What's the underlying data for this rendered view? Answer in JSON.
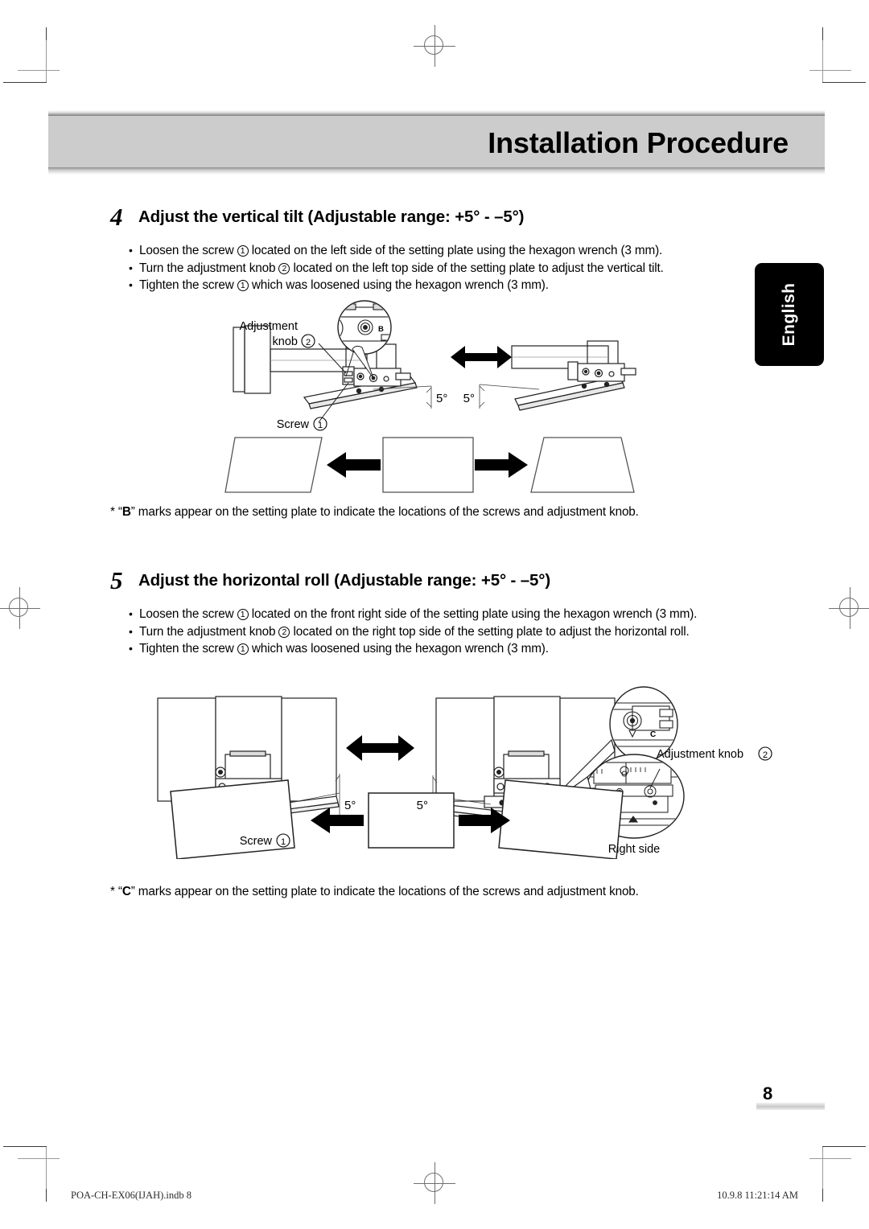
{
  "header": {
    "title": "Installation Procedure"
  },
  "language_tab": {
    "label": "English"
  },
  "steps": [
    {
      "number": "4",
      "title": "Adjust the vertical tilt (Adjustable range: +5° - –5°)",
      "bullets": [
        {
          "pre": "Loosen the screw ",
          "marker": "1",
          "post": " located on the left side of the setting plate using the hexagon wrench (3 mm)."
        },
        {
          "pre": "Turn the adjustment knob ",
          "marker": "2",
          "post": " located on the left top side of the setting plate to adjust the vertical tilt."
        },
        {
          "pre": "Tighten the screw ",
          "marker": "1",
          "post": " which was loosened using the hexagon wrench (3 mm)."
        }
      ],
      "figure_labels": {
        "adjustment_knob_line1": "Adjustment",
        "adjustment_knob_line2": "knob",
        "adjustment_knob_marker": "2",
        "screw_label": "Screw",
        "screw_marker": "1",
        "detail_mark": "B",
        "angle_left": "5°",
        "angle_right": "5°"
      },
      "footnote_prefix": "* “",
      "footnote_mark": "B",
      "footnote_suffix": "” marks appear on the setting plate to indicate the locations of the screws and adjustment knob."
    },
    {
      "number": "5",
      "title": "Adjust the horizontal roll (Adjustable range: +5° - –5°)",
      "bullets": [
        {
          "pre": "Loosen the screw ",
          "marker": "1",
          "post": " located on the front right side of the setting plate using the hexagon wrench (3 mm)."
        },
        {
          "pre": "Turn the adjustment knob ",
          "marker": "2",
          "post": " located on the right top side of the setting plate to adjust the horizontal roll."
        },
        {
          "pre": "Tighten the screw ",
          "marker": "1",
          "post": " which was loosened using the hexagon wrench (3 mm)."
        }
      ],
      "figure_labels": {
        "screw_label": "Screw",
        "screw_marker": "1",
        "adjustment_knob_label": "Adjustment knob",
        "adjustment_knob_marker": "2",
        "right_side_label": "Right side",
        "detail_mark": "C",
        "angle_left": "5°",
        "angle_right": "5°"
      },
      "footnote_prefix": "* “",
      "footnote_mark": "C",
      "footnote_suffix": "” marks appear on the setting plate to indicate the locations of the screws and adjustment knob."
    }
  ],
  "page_number": "8",
  "print_footer": {
    "file": "POA-CH-EX06(IJAH).indb   8",
    "timestamp": "10.9.8   11:21:14 AM"
  }
}
